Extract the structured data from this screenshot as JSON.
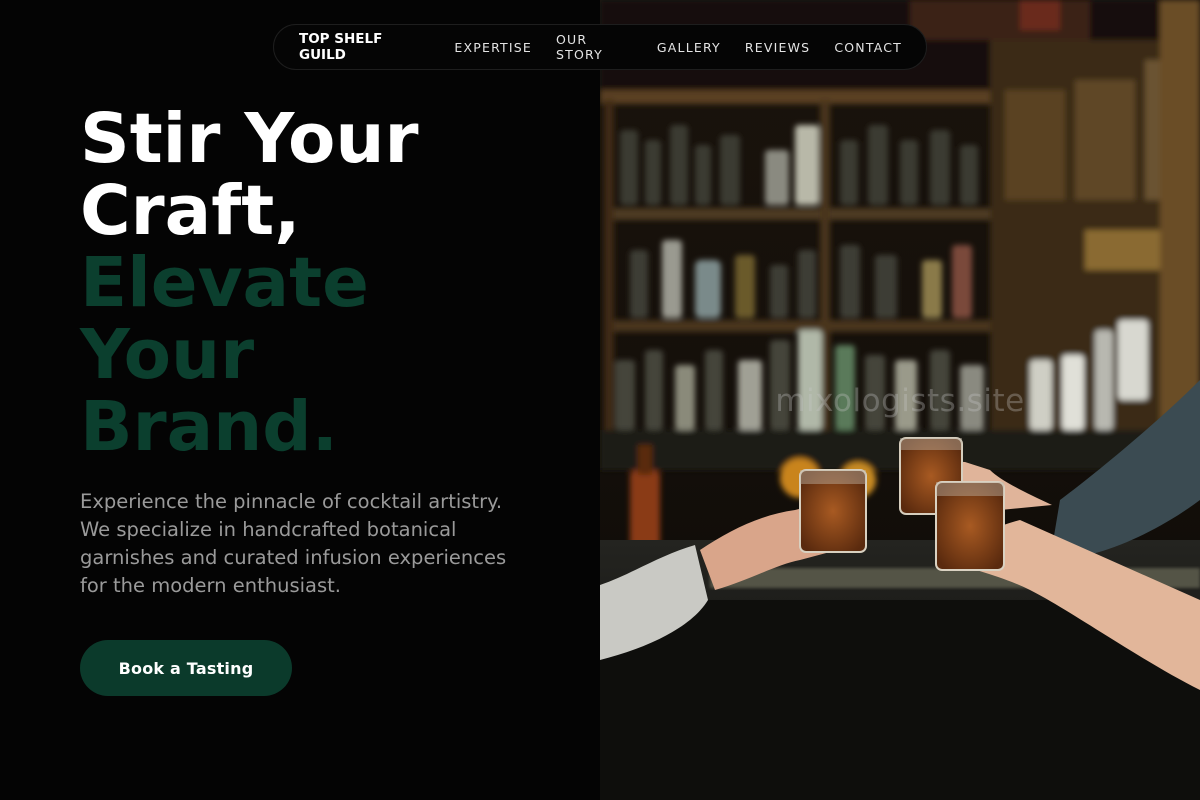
{
  "nav": {
    "brand": "TOP SHELF GUILD",
    "links": [
      "EXPERTISE",
      "OUR STORY",
      "GALLERY",
      "REVIEWS",
      "CONTACT"
    ]
  },
  "hero": {
    "title_lines_white": [
      "Stir Your",
      "Craft,"
    ],
    "title_lines_green": [
      "Elevate",
      "Your",
      "Brand."
    ],
    "description": "Experience the pinnacle of cocktail artistry. We specialize in handcrafted botanical garnishes and curated infusion experiences for the modern enthusiast.",
    "cta_label": "Book a Tasting"
  },
  "image": {
    "subject": "bar-toast-photo",
    "watermark": "mixologists.site"
  },
  "colors": {
    "background": "#040404",
    "accent_green": "#0b3f2e",
    "button_green": "#0b3a2b",
    "text_white": "#ffffff",
    "text_gray": "#9a9a9a"
  }
}
